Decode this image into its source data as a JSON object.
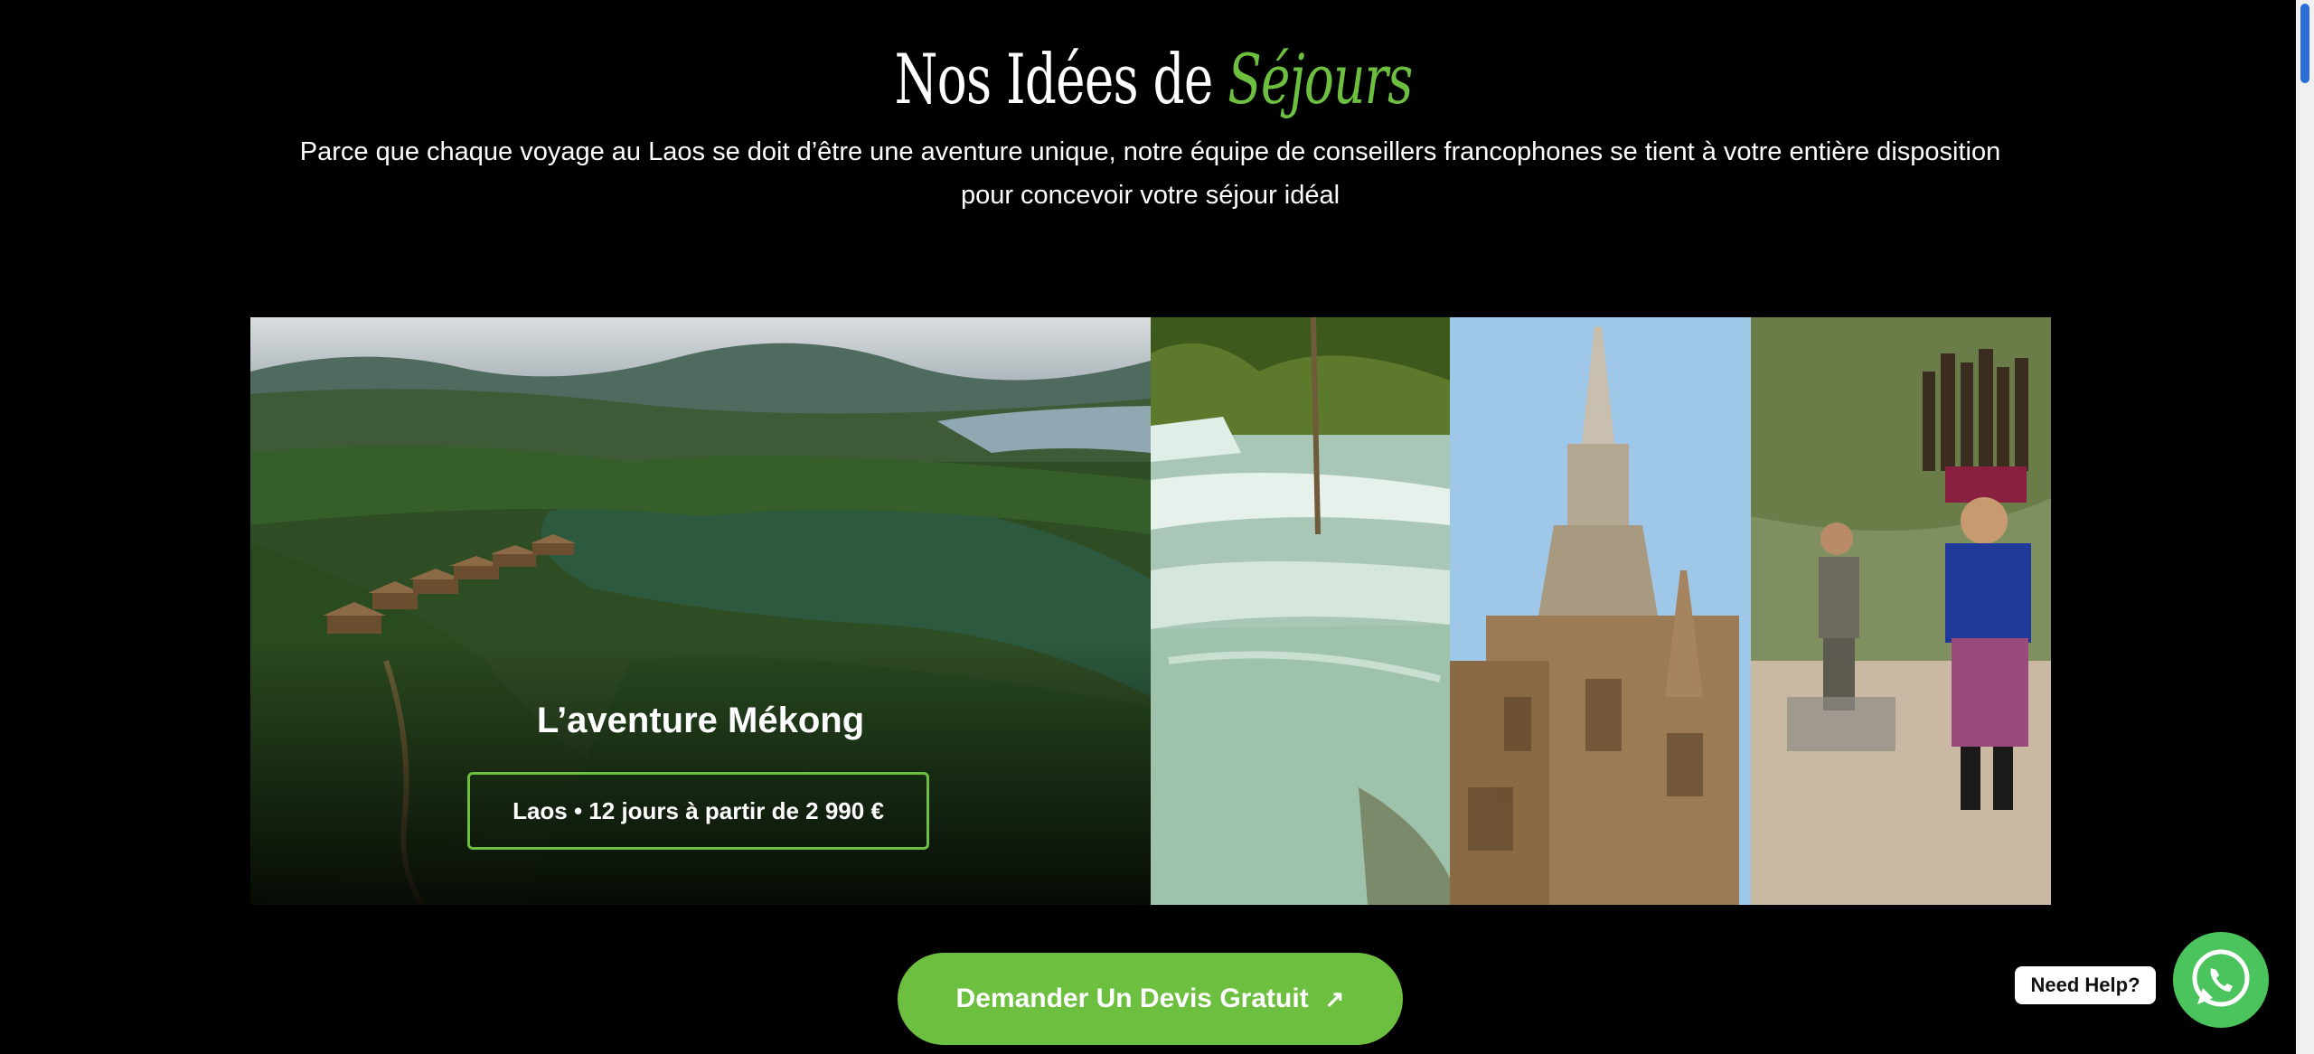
{
  "section": {
    "title_part1": "Nos Idées de",
    "title_accent": "Séjours",
    "intro": "Parce que chaque voyage au Laos se doit d’être une aventure unique, notre équipe de conseillers francophones se tient à votre entière disposition pour concevoir votre séjour idéal"
  },
  "featured_trip": {
    "title": "L’aventure Mékong",
    "info": "Laos • 12 jours à partir de 2 990 €"
  },
  "gallery": {
    "images": [
      "river-lodge-photo",
      "waterfall-photo",
      "temple-stupa-photo",
      "villager-carrying-wood-photo"
    ]
  },
  "cta": {
    "label": "Demander Un Devis Gratuit",
    "arrow": "↗"
  },
  "help": {
    "label": "Need Help?"
  },
  "colors": {
    "accent": "#6dbf3f",
    "whatsapp": "#4cc45d",
    "background": "#000000"
  },
  "icons": {
    "whatsapp": "whatsapp-icon",
    "arrow": "arrow-up-right-icon"
  }
}
